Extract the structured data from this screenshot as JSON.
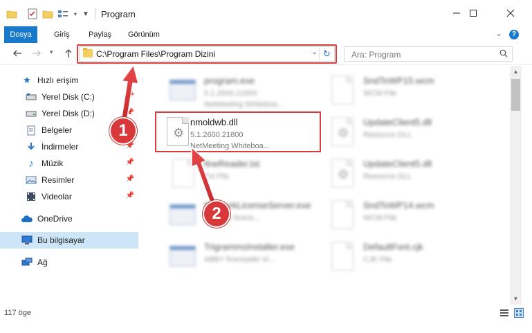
{
  "window": {
    "title": "Program",
    "controls": [
      "minimize",
      "maximize",
      "close"
    ]
  },
  "ribbon": {
    "tabs": [
      {
        "label": "Dosya",
        "active": true
      },
      {
        "label": "Giriş"
      },
      {
        "label": "Paylaş"
      },
      {
        "label": "Görünüm"
      }
    ],
    "help": "?"
  },
  "address": {
    "path": "C:\\Program Files\\Program Dizini",
    "search_placeholder": "Ara: Program"
  },
  "sidebar": {
    "items": [
      {
        "label": "Hızlı erişim",
        "icon": "star-icon",
        "pinned": false
      },
      {
        "label": "Yerel Disk (C:)",
        "icon": "drive-icon",
        "pinned": true
      },
      {
        "label": "Yerel Disk (D:)",
        "icon": "drive-icon",
        "pinned": true
      },
      {
        "label": "Belgeler",
        "icon": "documents-icon",
        "pinned": true
      },
      {
        "label": "İndirmeler",
        "icon": "download-icon",
        "pinned": true
      },
      {
        "label": "Müzik",
        "icon": "music-icon",
        "pinned": true
      },
      {
        "label": "Resimler",
        "icon": "pictures-icon",
        "pinned": true
      },
      {
        "label": "Videolar",
        "icon": "video-icon",
        "pinned": true
      },
      {
        "label": "OneDrive",
        "icon": "cloud-icon",
        "pinned": false
      },
      {
        "label": "Bu bilgisayar",
        "icon": "computer-icon",
        "pinned": false,
        "selected": true
      },
      {
        "label": "Ağ",
        "icon": "network-icon",
        "pinned": false
      }
    ]
  },
  "files": {
    "left_column": [
      {
        "name": "program.exe",
        "line2": "5.1.2600.21800",
        "line3": "NetMeeting Whiteboa...",
        "type": "exe",
        "blurred": true
      },
      {
        "name": "nmoldwb.dll",
        "line2": "5.1.2600.21800",
        "line3": "NetMeeting Whiteboa...",
        "type": "dll",
        "blurred": false,
        "highlighted": true
      },
      {
        "name": "fineReader.txt",
        "line2": "Txt File",
        "line3": "",
        "type": "txt",
        "blurred": true
      },
      {
        "name": "NetworkLicenseServer.exe",
        "line2": "Network licens...",
        "line3": "",
        "type": "exe",
        "blurred": true
      },
      {
        "name": "TrigrammsInstaller.exe",
        "line2": "ABBY finereader tri...",
        "line3": "",
        "type": "exe",
        "blurred": true
      }
    ],
    "right_column": [
      {
        "name": "SndToWP15.wcm",
        "line2": "WCM File",
        "line3": "",
        "type": "doc",
        "blurred": true
      },
      {
        "name": "UpdateClient5.dll",
        "line2": "Resource DLL",
        "line3": "",
        "type": "dll",
        "blurred": true
      },
      {
        "name": "UpdateClient5.dll",
        "line2": "Resource DLL",
        "line3": "",
        "type": "dll",
        "blurred": true
      },
      {
        "name": "SndToWP14.wcm",
        "line2": "WCM File",
        "line3": "",
        "type": "doc",
        "blurred": true
      },
      {
        "name": "DefaultFont.cjk",
        "line2": "CJK File",
        "line3": "",
        "type": "doc",
        "blurred": true
      }
    ]
  },
  "status": {
    "count": "117 öge"
  },
  "annotations": {
    "marker1": "1",
    "marker2": "2",
    "color": "#d9383a"
  }
}
